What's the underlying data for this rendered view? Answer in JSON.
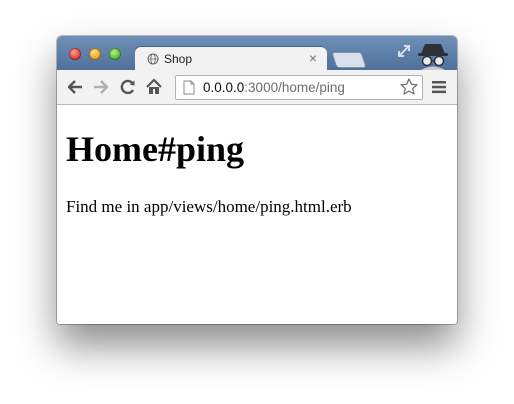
{
  "window": {
    "controls": [
      "close",
      "minimize",
      "maximize"
    ]
  },
  "tab": {
    "title": "Shop",
    "close_label": "×",
    "favicon": "globe-icon"
  },
  "toolbar": {
    "icons": [
      "back-arrow-icon",
      "forward-arrow-icon",
      "reload-icon",
      "home-icon",
      "star-icon",
      "menu-icon"
    ],
    "url_host": "0.0.0.0",
    "url_rest": ":3000/home/ping"
  },
  "page": {
    "heading": "Home#ping",
    "text": "Find me in app/views/home/ping.html.erb"
  }
}
